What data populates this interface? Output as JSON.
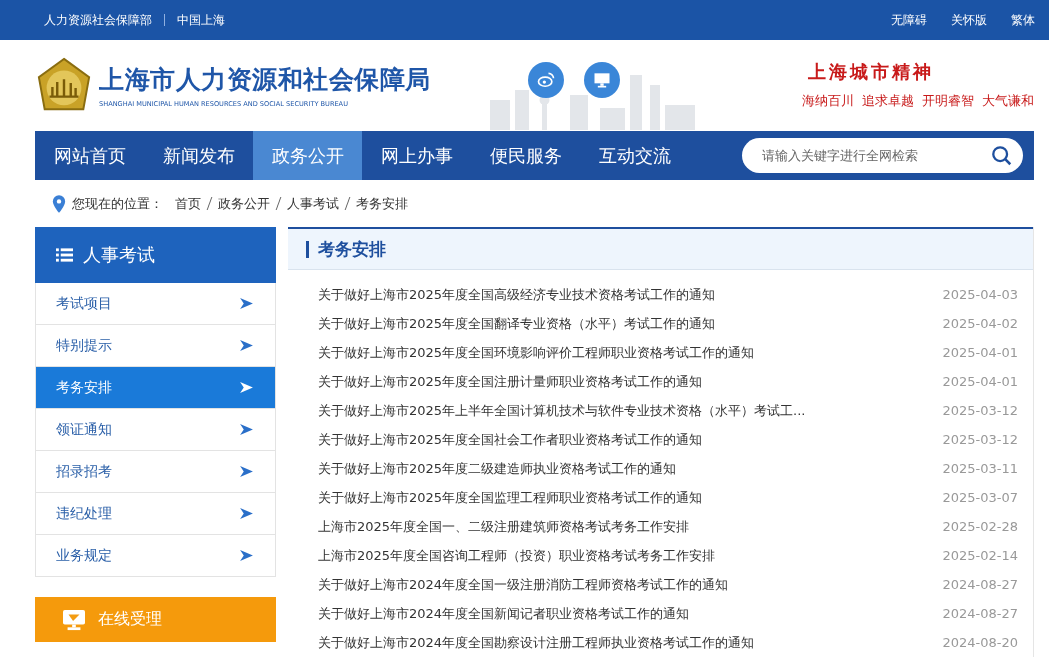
{
  "top_bar": {
    "left_links": [
      "人力资源社会保障部",
      "中国上海"
    ],
    "right_links": [
      "无障碍",
      "关怀版",
      "繁体"
    ]
  },
  "header": {
    "title": "上海市人力资源和社会保障局",
    "subtitle": "SHANGHAI MUNICIPAL HUMAN RESOURCES AND SOCIAL SECURITY BUREAU",
    "slogan_title": "上海城市精神",
    "slogan_items": [
      "海纳百川",
      "追求卓越",
      "开明睿智",
      "大气谦和"
    ]
  },
  "nav": {
    "items": [
      {
        "label": "网站首页",
        "selected": false
      },
      {
        "label": "新闻发布",
        "selected": false
      },
      {
        "label": "政务公开",
        "selected": true
      },
      {
        "label": "网上办事",
        "selected": false
      },
      {
        "label": "便民服务",
        "selected": false
      },
      {
        "label": "互动交流",
        "selected": false
      }
    ],
    "search": {
      "placeholder": "请输入关键字进行全网检索"
    }
  },
  "breadcrumb": {
    "label": "您现在的位置：",
    "items": [
      "首页",
      "政务公开",
      "人事考试",
      "考务安排"
    ]
  },
  "sidebar": {
    "title": "人事考试",
    "items": [
      {
        "label": "考试项目",
        "selected": false
      },
      {
        "label": "特别提示",
        "selected": false
      },
      {
        "label": "考务安排",
        "selected": true
      },
      {
        "label": "领证通知",
        "selected": false
      },
      {
        "label": "招录招考",
        "selected": false
      },
      {
        "label": "违纪处理",
        "selected": false
      },
      {
        "label": "业务规定",
        "selected": false
      }
    ],
    "online_button": "在线受理"
  },
  "content": {
    "title": "考务安排",
    "articles": [
      {
        "title": "关于做好上海市2025年度全国高级经济专业技术资格考试工作的通知",
        "date": "2025-04-03"
      },
      {
        "title": "关于做好上海市2025年度全国翻译专业资格（水平）考试工作的通知",
        "date": "2025-04-02"
      },
      {
        "title": "关于做好上海市2025年度全国环境影响评价工程师职业资格考试工作的通知",
        "date": "2025-04-01"
      },
      {
        "title": "关于做好上海市2025年度全国注册计量师职业资格考试工作的通知",
        "date": "2025-04-01"
      },
      {
        "title": "关于做好上海市2025年上半年全国计算机技术与软件专业技术资格（水平）考试工...",
        "date": "2025-03-12"
      },
      {
        "title": "关于做好上海市2025年度全国社会工作者职业资格考试工作的通知",
        "date": "2025-03-12"
      },
      {
        "title": "关于做好上海市2025年度二级建造师执业资格考试工作的通知",
        "date": "2025-03-11"
      },
      {
        "title": "关于做好上海市2025年度全国监理工程师职业资格考试工作的通知",
        "date": "2025-03-07"
      },
      {
        "title": "上海市2025年度全国一、二级注册建筑师资格考试考务工作安排",
        "date": "2025-02-28"
      },
      {
        "title": "上海市2025年度全国咨询工程师（投资）职业资格考试考务工作安排",
        "date": "2025-02-14"
      },
      {
        "title": "关于做好上海市2024年度全国一级注册消防工程师资格考试工作的通知",
        "date": "2024-08-27"
      },
      {
        "title": "关于做好上海市2024年度全国新闻记者职业资格考试工作的通知",
        "date": "2024-08-27"
      },
      {
        "title": "关于做好上海市2024年度全国勘察设计注册工程师执业资格考试工作的通知",
        "date": "2024-08-20"
      }
    ]
  }
}
